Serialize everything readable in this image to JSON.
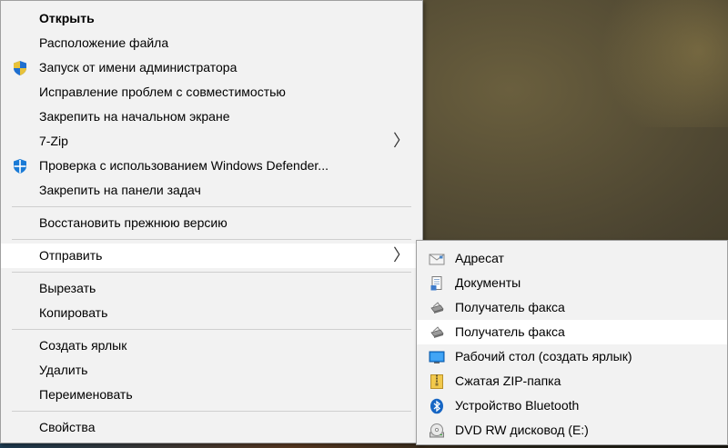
{
  "main_menu": {
    "items": [
      {
        "label": "Открыть",
        "bold": true
      },
      {
        "label": "Расположение файла"
      },
      {
        "label": "Запуск от имени администратора",
        "icon": "uac-shield-icon"
      },
      {
        "label": "Исправление проблем с совместимостью"
      },
      {
        "label": "Закрепить на начальном экране"
      },
      {
        "label": "7-Zip",
        "submenu": true
      },
      {
        "label": "Проверка с использованием Windows Defender...",
        "icon": "windows-defender-icon"
      },
      {
        "label": "Закрепить на панели задач"
      },
      {
        "label": "Восстановить прежнюю версию"
      },
      {
        "label": "Отправить",
        "submenu": true,
        "highlighted": true
      },
      {
        "label": "Вырезать"
      },
      {
        "label": "Копировать"
      },
      {
        "label": "Создать ярлык"
      },
      {
        "label": "Удалить"
      },
      {
        "label": "Переименовать"
      },
      {
        "label": "Свойства"
      }
    ],
    "arrow_glyph": "〉"
  },
  "send_to_menu": {
    "items": [
      {
        "label": "Адресат",
        "icon": "mail-recipient-icon"
      },
      {
        "label": "Документы",
        "icon": "documents-icon"
      },
      {
        "label": "Получатель факса",
        "icon": "fax-icon"
      },
      {
        "label": "Получатель факса",
        "icon": "fax-icon",
        "highlighted": true
      },
      {
        "label": "Рабочий стол (создать ярлык)",
        "icon": "desktop-icon"
      },
      {
        "label": "Сжатая ZIP-папка",
        "icon": "zip-folder-icon"
      },
      {
        "label": "Устройство Bluetooth",
        "icon": "bluetooth-icon"
      },
      {
        "label": "DVD RW дисковод (E:)",
        "icon": "dvd-drive-icon"
      }
    ]
  },
  "colors": {
    "menu_bg": "#f2f2f2",
    "highlight_bg": "#ffffff",
    "separator": "#cfcfcf",
    "accent_blue": "#0078d7"
  }
}
